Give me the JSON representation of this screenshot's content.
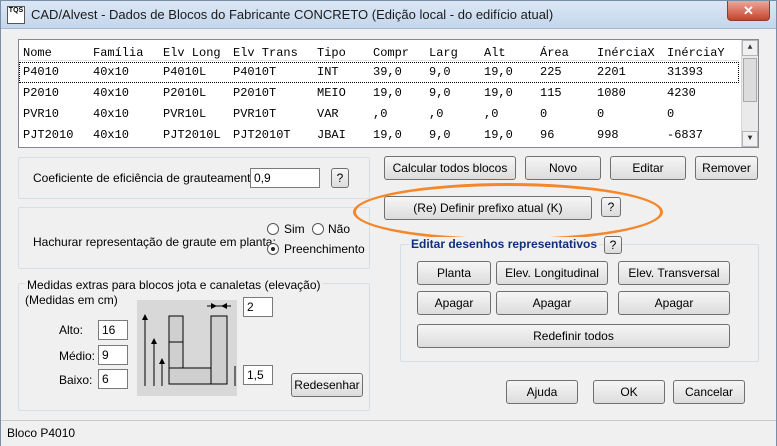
{
  "window": {
    "title": "CAD/Alvest - Dados de Blocos do Fabricante  CONCRETO (Edição local - do edifício atual)",
    "icon_text": "TQS",
    "close_glyph": "✕"
  },
  "table": {
    "headers": [
      "Nome",
      "Família",
      "Elv Long",
      "Elv Trans",
      "Tipo",
      "Compr",
      "Larg",
      "Alt",
      "Área",
      "InérciaX",
      "InérciaY"
    ],
    "rows": [
      [
        "P4010",
        "40x10",
        "P4010L",
        "P4010T",
        "INT",
        "39,0",
        "9,0",
        "19,0",
        "225",
        "2201",
        "31393"
      ],
      [
        "P2010",
        "40x10",
        "P2010L",
        "P2010T",
        "MEIO",
        "19,0",
        "9,0",
        "19,0",
        "115",
        "1080",
        "4230"
      ],
      [
        "PVR10",
        "40x10",
        "PVR10L",
        "PVR10T",
        "VAR",
        ",0",
        ",0",
        ",0",
        "0",
        "0",
        "0"
      ],
      [
        "PJT2010",
        "40x10",
        "PJT2010L",
        "PJT2010T",
        "JBAI",
        "19,0",
        "9,0",
        "19,0",
        "96",
        "998",
        "-6837"
      ]
    ]
  },
  "efficiency": {
    "label": "Coeficiente de eficiência de grauteamento:",
    "value": "0,9",
    "help": "?"
  },
  "hatch": {
    "label": "Hachurar representação de graute em planta:",
    "opt_sim": "Sim",
    "opt_nao": "Não",
    "opt_preench": "Preenchimento"
  },
  "extras": {
    "legend": "Medidas extras para blocos jota e canaletas (elevação)",
    "units": "(Medidas em cm)",
    "alto_label": "Alto:",
    "alto_value": "16",
    "medio_label": "Médio:",
    "medio_value": "9",
    "baixo_label": "Baixo:",
    "baixo_value": "6",
    "top_value": "2",
    "bottom_value": "1,5",
    "redraw": "Redesenhar"
  },
  "actions": {
    "calc_all": "Calcular todos blocos",
    "new": "Novo",
    "edit": "Editar",
    "remove": "Remover",
    "prefix": "(Re) Definir prefixo atual (K)",
    "prefix_help": "?"
  },
  "drawings": {
    "legend": "Editar desenhos representativos",
    "help": "?",
    "planta": "Planta",
    "elev_long": "Elev. Longitudinal",
    "elev_trans": "Elev. Transversal",
    "apagar": "Apagar",
    "redefine_all": "Redefinir todos"
  },
  "footer": {
    "help": "Ajuda",
    "ok": "OK",
    "cancel": "Cancelar"
  },
  "status": {
    "text": "Bloco P4010"
  }
}
